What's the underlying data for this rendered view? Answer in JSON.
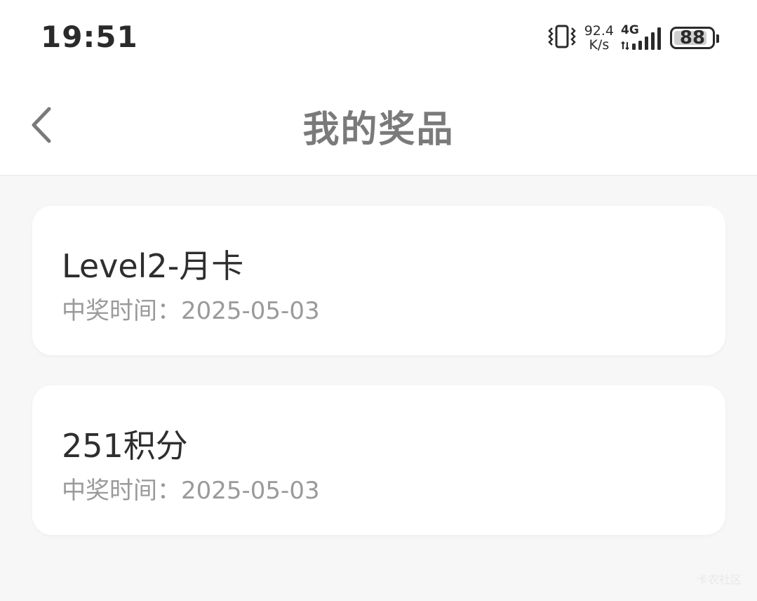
{
  "status_bar": {
    "time": "19:51",
    "net_speed_value": "92.4",
    "net_speed_unit": "K/s",
    "network_type": "4G",
    "battery_level": "88",
    "battery_fraction": 0.88,
    "icons": [
      "vibrate-icon",
      "signal-icon",
      "battery-icon"
    ]
  },
  "header": {
    "title": "我的奖品",
    "back_icon": "chevron-left-icon"
  },
  "prizes": [
    {
      "name": "Level2-月卡",
      "time_label": "中奖时间：2025-05-03"
    },
    {
      "name": "251积分",
      "time_label": "中奖时间：2025-05-03"
    }
  ],
  "watermark": "卡农社区",
  "colors": {
    "background": "#f7f7f7",
    "card": "#ffffff",
    "title": "#7a7a7a",
    "prize_name": "#2e2e2e",
    "prize_time": "#9a9a9a"
  }
}
